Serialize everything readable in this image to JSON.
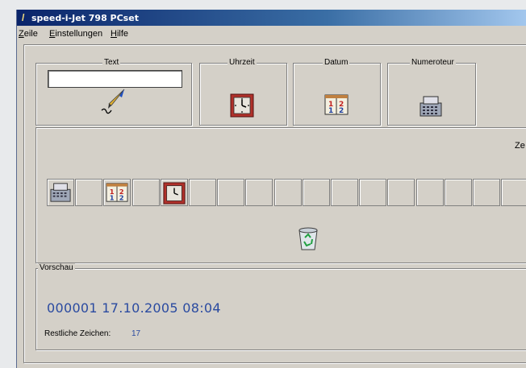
{
  "window": {
    "title": "speed-i-Jet 798 PCset"
  },
  "menu": {
    "items": [
      "Zeile",
      "Einstellungen",
      "Hilfe"
    ]
  },
  "sources": {
    "text_label": "Text",
    "time_label": "Uhrzeit",
    "date_label": "Datum",
    "numerator_label": "Numeroteur",
    "text_value": ""
  },
  "line": {
    "label_partial": "Ze",
    "slot_count": 18,
    "filled_slots": [
      {
        "index": 0,
        "icon": "numerator-icon"
      },
      {
        "index": 2,
        "icon": "calendar-icon"
      },
      {
        "index": 4,
        "icon": "clock-icon"
      }
    ],
    "trash_icon": "recycle-bin-icon"
  },
  "preview": {
    "label": "Vorschau",
    "text": "000001 17.10.2005 08:04",
    "remaining_label": "Restliche Zeichen:",
    "remaining_value": "17"
  },
  "colors": {
    "title_bar": "#0a246a",
    "window_bg": "#d4d0c8",
    "preview_text": "#2a4aa0",
    "clock_red": "#b0302a"
  }
}
